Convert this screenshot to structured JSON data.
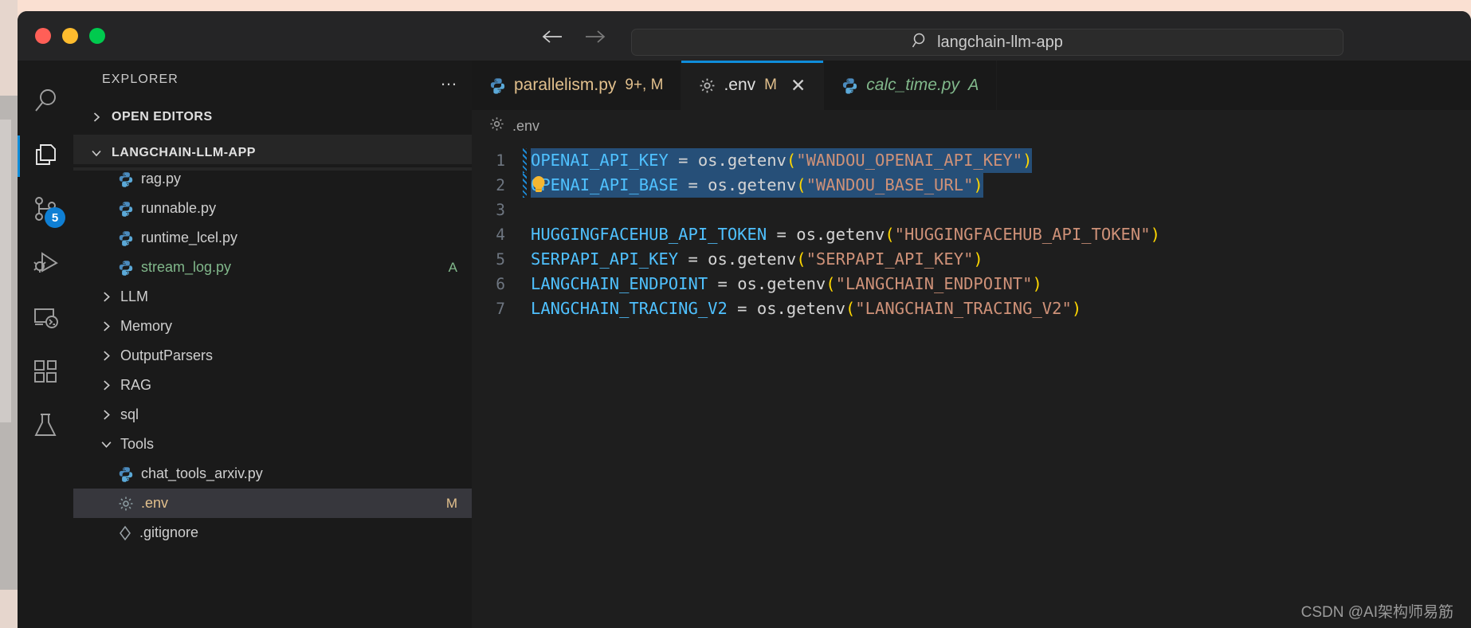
{
  "window": {
    "traffic_lights": [
      "close",
      "minimize",
      "maximize"
    ],
    "nav_back": "←",
    "nav_forward": "→",
    "quick_input_text": "langchain-llm-app",
    "search_icon": "search-icon"
  },
  "activity_bar": {
    "items": [
      {
        "name": "search",
        "icon": "search-icon",
        "active": false,
        "badge": ""
      },
      {
        "name": "explorer",
        "icon": "files-icon",
        "active": true,
        "badge": ""
      },
      {
        "name": "source-control",
        "icon": "source-control-icon",
        "active": false,
        "badge": "5"
      },
      {
        "name": "run-and-debug",
        "icon": "run-debug-icon",
        "active": false,
        "badge": ""
      },
      {
        "name": "remote-explorer",
        "icon": "remote-icon",
        "active": false,
        "badge": ""
      },
      {
        "name": "extensions",
        "icon": "extensions-icon",
        "active": false,
        "badge": ""
      },
      {
        "name": "testing",
        "icon": "beaker-icon",
        "active": false,
        "badge": ""
      }
    ]
  },
  "sidebar": {
    "title": "EXPLORER",
    "more_actions": "…",
    "sections": [
      {
        "label": "OPEN EDITORS",
        "expanded": false
      },
      {
        "label": "LANGCHAIN-LLM-APP",
        "expanded": true
      }
    ],
    "tree": [
      {
        "label": "rag.py",
        "type": "file",
        "icon": "python-icon",
        "indent": 1,
        "status": "",
        "state": "normal",
        "clipped": true
      },
      {
        "label": "runnable.py",
        "type": "file",
        "icon": "python-icon",
        "indent": 1,
        "status": "",
        "state": "normal"
      },
      {
        "label": "runtime_lcel.py",
        "type": "file",
        "icon": "python-icon",
        "indent": 1,
        "status": "",
        "state": "normal"
      },
      {
        "label": "stream_log.py",
        "type": "file",
        "icon": "python-icon",
        "indent": 1,
        "status": "A",
        "state": "added"
      },
      {
        "label": "LLM",
        "type": "folder",
        "icon": "chevron-right-icon",
        "indent": 0,
        "status": "",
        "state": "normal"
      },
      {
        "label": "Memory",
        "type": "folder",
        "icon": "chevron-right-icon",
        "indent": 0,
        "status": "",
        "state": "normal"
      },
      {
        "label": "OutputParsers",
        "type": "folder",
        "icon": "chevron-right-icon",
        "indent": 0,
        "status": "",
        "state": "normal"
      },
      {
        "label": "RAG",
        "type": "folder",
        "icon": "chevron-right-icon",
        "indent": 0,
        "status": "",
        "state": "normal"
      },
      {
        "label": "sql",
        "type": "folder",
        "icon": "chevron-right-icon",
        "indent": 0,
        "status": "",
        "state": "normal"
      },
      {
        "label": "Tools",
        "type": "folder",
        "icon": "chevron-down-icon",
        "indent": 0,
        "status": "",
        "state": "normal"
      },
      {
        "label": "chat_tools_arxiv.py",
        "type": "file",
        "icon": "python-icon",
        "indent": 1,
        "status": "",
        "state": "normal"
      },
      {
        "label": ".env",
        "type": "file",
        "icon": "gear-icon",
        "indent": 1,
        "status": "M",
        "state": "modified",
        "selected": true
      },
      {
        "label": ".gitignore",
        "type": "file",
        "icon": "git-icon",
        "indent": 1,
        "status": "",
        "state": "normal"
      }
    ]
  },
  "editor": {
    "tabs": [
      {
        "label": "parallelism.py",
        "icon": "python-icon",
        "meta": "9+, M",
        "active": false,
        "state": "modified",
        "closable": false
      },
      {
        "label": ".env",
        "icon": "gear-icon",
        "meta": "M",
        "active": true,
        "state": "normal",
        "closable": true,
        "close_label": "✕"
      },
      {
        "label": "calc_time.py",
        "icon": "python-icon",
        "meta": "A",
        "active": false,
        "state": "added",
        "closable": false
      }
    ],
    "breadcrumb": {
      "icon": "gear-icon",
      "label": ".env"
    },
    "lines": [
      {
        "number": "1",
        "selected": true,
        "diff": true,
        "bulb": false,
        "tokens": [
          {
            "t": "OPENAI_API_KEY",
            "c": "var"
          },
          {
            "t": " = ",
            "c": "plain"
          },
          {
            "t": "os.getenv",
            "c": "plain"
          },
          {
            "t": "(",
            "c": "paren"
          },
          {
            "t": "\"WANDOU_OPENAI_API_KEY\"",
            "c": "str"
          },
          {
            "t": ")",
            "c": "paren"
          }
        ]
      },
      {
        "number": "2",
        "selected": true,
        "diff": true,
        "bulb": true,
        "tokens": [
          {
            "t": "OPENAI_API_BASE",
            "c": "var"
          },
          {
            "t": " = ",
            "c": "plain"
          },
          {
            "t": "os.getenv",
            "c": "plain"
          },
          {
            "t": "(",
            "c": "paren"
          },
          {
            "t": "\"WANDOU_BASE_URL\"",
            "c": "str"
          },
          {
            "t": ")",
            "c": "paren"
          }
        ]
      },
      {
        "number": "3",
        "selected": false,
        "diff": false,
        "bulb": false,
        "tokens": []
      },
      {
        "number": "4",
        "selected": false,
        "diff": false,
        "bulb": false,
        "tokens": [
          {
            "t": "HUGGINGFACEHUB_API_TOKEN",
            "c": "var"
          },
          {
            "t": " = ",
            "c": "plain"
          },
          {
            "t": "os.getenv",
            "c": "plain"
          },
          {
            "t": "(",
            "c": "paren"
          },
          {
            "t": "\"HUGGINGFACEHUB_API_TOKEN\"",
            "c": "str"
          },
          {
            "t": ")",
            "c": "paren"
          }
        ]
      },
      {
        "number": "5",
        "selected": false,
        "diff": false,
        "bulb": false,
        "tokens": [
          {
            "t": "SERPAPI_API_KEY",
            "c": "var"
          },
          {
            "t": " = ",
            "c": "plain"
          },
          {
            "t": "os.getenv",
            "c": "plain"
          },
          {
            "t": "(",
            "c": "paren"
          },
          {
            "t": "\"SERPAPI_API_KEY\"",
            "c": "str"
          },
          {
            "t": ")",
            "c": "paren"
          }
        ]
      },
      {
        "number": "6",
        "selected": false,
        "diff": false,
        "bulb": false,
        "tokens": [
          {
            "t": "LANGCHAIN_ENDPOINT",
            "c": "var"
          },
          {
            "t": " = ",
            "c": "plain"
          },
          {
            "t": "os.getenv",
            "c": "plain"
          },
          {
            "t": "(",
            "c": "paren"
          },
          {
            "t": "\"LANGCHAIN_ENDPOINT\"",
            "c": "str"
          },
          {
            "t": ")",
            "c": "paren"
          }
        ]
      },
      {
        "number": "7",
        "selected": false,
        "diff": false,
        "bulb": false,
        "tokens": [
          {
            "t": "LANGCHAIN_TRACING_V2",
            "c": "var"
          },
          {
            "t": " = ",
            "c": "plain"
          },
          {
            "t": "os.getenv",
            "c": "plain"
          },
          {
            "t": "(",
            "c": "paren"
          },
          {
            "t": "\"LANGCHAIN_TRACING_V2\"",
            "c": "str"
          },
          {
            "t": ")",
            "c": "paren"
          }
        ]
      }
    ]
  },
  "watermark": "CSDN @AI架构师易筋",
  "colors": {
    "accent": "#0f8ddb",
    "selection": "#264f78",
    "modified": "#e2c08d",
    "added": "#81b88b",
    "variable": "#4fc1ff",
    "string": "#ce9178",
    "paren": "#ffd700",
    "editor_bg": "#1e1e1e",
    "sidebar_bg": "#1a1a1a"
  }
}
